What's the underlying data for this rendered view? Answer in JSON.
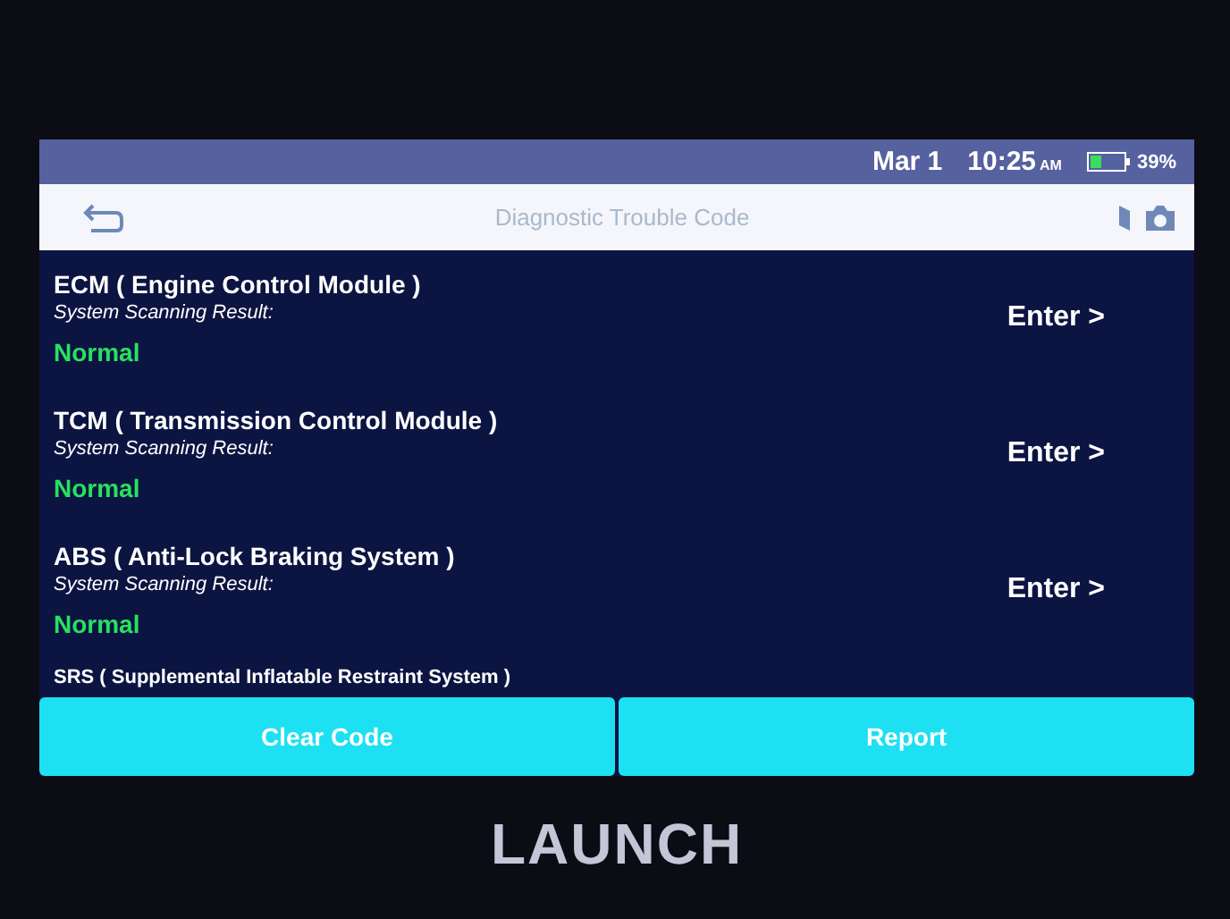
{
  "status_bar": {
    "date": "Mar 1",
    "time": "10:25",
    "ampm": "AM",
    "battery": "39%"
  },
  "title_bar": {
    "title": "Diagnostic Trouble Code"
  },
  "systems": [
    {
      "name": "ECM ( Engine Control Module )",
      "label": "System Scanning Result:",
      "result": "Normal",
      "action": "Enter >"
    },
    {
      "name": "TCM ( Transmission Control Module )",
      "label": "System Scanning Result:",
      "result": "Normal",
      "action": "Enter >"
    },
    {
      "name": "ABS ( Anti-Lock Braking System )",
      "label": "System Scanning Result:",
      "result": "Normal",
      "action": "Enter >"
    },
    {
      "name": "SRS ( Supplemental Inflatable Restraint System )"
    }
  ],
  "buttons": [
    "Clear Code",
    "Report"
  ],
  "device": {
    "brand": "LAUNCH"
  }
}
